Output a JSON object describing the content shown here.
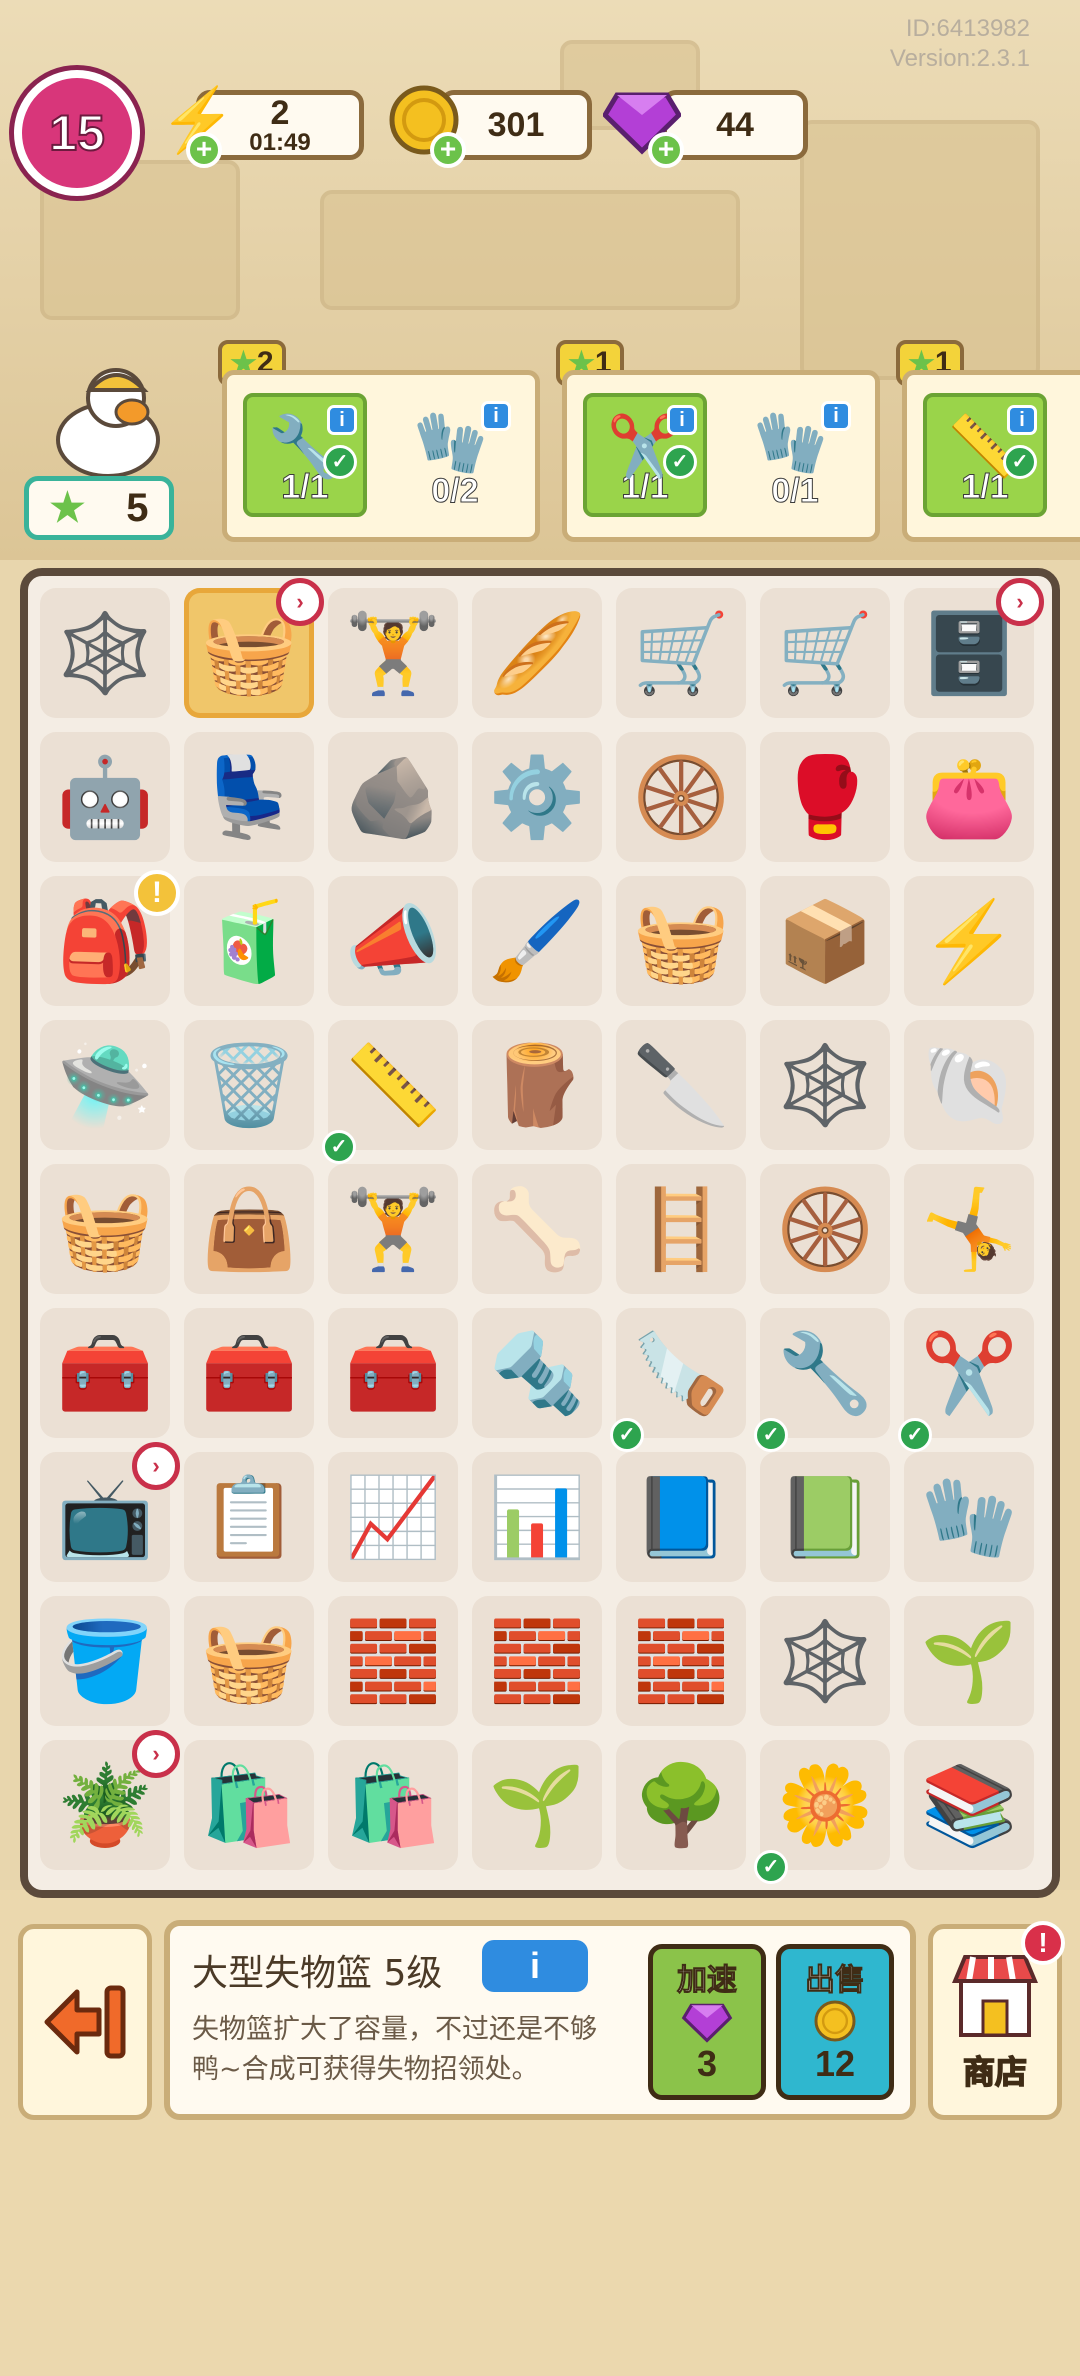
{
  "meta": {
    "id": "ID:6413982",
    "version": "Version:2.3.1"
  },
  "hud": {
    "level": "15",
    "energy": {
      "value": "2",
      "timer": "01:49",
      "icon": "lightning-icon"
    },
    "coins": {
      "value": "301",
      "icon": "coin-icon"
    },
    "gems": {
      "value": "44",
      "icon": "gem-icon"
    },
    "stars": "5"
  },
  "orders": [
    {
      "stars": "2",
      "items": [
        {
          "icon": "wrench",
          "progress": "1/1",
          "done": true
        },
        {
          "icon": "gloves",
          "progress": "0/2",
          "done": false
        }
      ]
    },
    {
      "stars": "1",
      "items": [
        {
          "icon": "pruning-shears",
          "progress": "1/1",
          "done": true
        },
        {
          "icon": "gloves",
          "progress": "0/1",
          "done": false
        }
      ]
    },
    {
      "stars": "1",
      "items": [
        {
          "icon": "tape-measure",
          "progress": "1/1",
          "done": true
        }
      ]
    }
  ],
  "board": [
    [
      {
        "g": "🕸️",
        "n": "cobweb-chest"
      },
      {
        "g": "🧺",
        "n": "large-lost-basket",
        "sel": true,
        "tag": true
      },
      {
        "g": "🏋️",
        "n": "weight-plates"
      },
      {
        "g": "🥖",
        "n": "foam-block"
      },
      {
        "g": "🛒",
        "n": "cart-with-boards"
      },
      {
        "g": "🛒",
        "n": "shopping-basket-cart"
      },
      {
        "g": "🗄️",
        "n": "drawer-cabinet",
        "tag": true
      }
    ],
    [
      {
        "g": "🤖",
        "n": "robot-vacuum"
      },
      {
        "g": "💺",
        "n": "neck-pillow"
      },
      {
        "g": "🪨",
        "n": "rubble"
      },
      {
        "g": "⚙️",
        "n": "caster-wheel"
      },
      {
        "g": "🛞",
        "n": "double-caster"
      },
      {
        "g": "🥊",
        "n": "boxing-glove"
      },
      {
        "g": "👛",
        "n": "wallet"
      }
    ],
    [
      {
        "g": "🎒",
        "n": "pink-backpack",
        "alert": true
      },
      {
        "g": "🧃",
        "n": "water-cup"
      },
      {
        "g": "📣",
        "n": "megaphone"
      },
      {
        "g": "🖌️",
        "n": "paint-roller"
      },
      {
        "g": "🧺",
        "n": "yellow-basket"
      },
      {
        "g": "📦",
        "n": "cardboard-box"
      },
      {
        "g": "⚡",
        "n": "energy-basket"
      }
    ],
    [
      {
        "g": "🛸",
        "n": "blue-robot-vacuum"
      },
      {
        "g": "🗑️",
        "n": "cobweb-bin"
      },
      {
        "g": "📏",
        "n": "tape-measure",
        "chk": true
      },
      {
        "g": "🪵",
        "n": "foam-roll"
      },
      {
        "g": "🔪",
        "n": "utility-knife"
      },
      {
        "g": "🕸️",
        "n": "cobweb-chest-2"
      },
      {
        "g": "🐚",
        "n": "shell"
      }
    ],
    [
      {
        "g": "🧺",
        "n": "gym-basket"
      },
      {
        "g": "👜",
        "n": "gym-bag"
      },
      {
        "g": "🏋️",
        "n": "dumbbell-silver"
      },
      {
        "g": "🦴",
        "n": "dumbbell-teal"
      },
      {
        "g": "🪜",
        "n": "chest-expander"
      },
      {
        "g": "🛞",
        "n": "ab-wheel"
      },
      {
        "g": "🤸",
        "n": "hand-grip"
      }
    ],
    [
      {
        "g": "🧰",
        "n": "open-toolbox"
      },
      {
        "g": "🧰",
        "n": "green-toolbox"
      },
      {
        "g": "🧰",
        "n": "tool-tray"
      },
      {
        "g": "🔩",
        "n": "staple"
      },
      {
        "g": "🪚",
        "n": "hacksaw",
        "chk": true
      },
      {
        "g": "🔧",
        "n": "wrench",
        "chk": true
      },
      {
        "g": "✂️",
        "n": "pruning-shears",
        "chk": true
      }
    ],
    [
      {
        "g": "📺",
        "n": "duck-tv",
        "tag": true
      },
      {
        "g": "📋",
        "n": "clipboard-chart"
      },
      {
        "g": "📈",
        "n": "line-chart-notebook"
      },
      {
        "g": "📊",
        "n": "bar-chart-notebook"
      },
      {
        "g": "📘",
        "n": "duck-book-1"
      },
      {
        "g": "📗",
        "n": "duck-book-3"
      },
      {
        "g": "🧤",
        "n": "garden-gloves"
      }
    ],
    [
      {
        "g": "🪣",
        "n": "tool-bucket"
      },
      {
        "g": "🧺",
        "n": "tool-basket"
      },
      {
        "g": "🧱",
        "n": "pink-brick"
      },
      {
        "g": "🧱",
        "n": "two-bricks"
      },
      {
        "g": "🧱",
        "n": "brick-pile"
      },
      {
        "g": "🕸️",
        "n": "cobweb-chest-3"
      },
      {
        "g": "🌱",
        "n": "seed-packet"
      }
    ],
    [
      {
        "g": "🪴",
        "n": "seedling-pot",
        "tag": true
      },
      {
        "g": "🛍️",
        "n": "soil-bag-small"
      },
      {
        "g": "🛍️",
        "n": "soil-bag-large"
      },
      {
        "g": "🌱",
        "n": "potted-sprout"
      },
      {
        "g": "🌳",
        "n": "potted-tree"
      },
      {
        "g": "🌼",
        "n": "flowering-tree",
        "chk": true
      },
      {
        "g": "📚",
        "n": "stacked-bags"
      }
    ]
  ],
  "selected_item": {
    "title": "大型失物篮 5级",
    "info_label": "i",
    "description": "失物篮扩大了容量，不过还是不够鸭~合成可获得失物招领处。"
  },
  "actions": {
    "speedup": {
      "label": "加速",
      "cost": "3",
      "icon": "gem-icon"
    },
    "sell": {
      "label": "出售",
      "price": "12",
      "icon": "coin-icon"
    }
  },
  "shop": {
    "label": "商店"
  },
  "colors": {
    "accent": "#d8367a",
    "speedup": "#8bc34a",
    "sell": "#2fb7cf",
    "board_border": "#5b4a3b"
  }
}
